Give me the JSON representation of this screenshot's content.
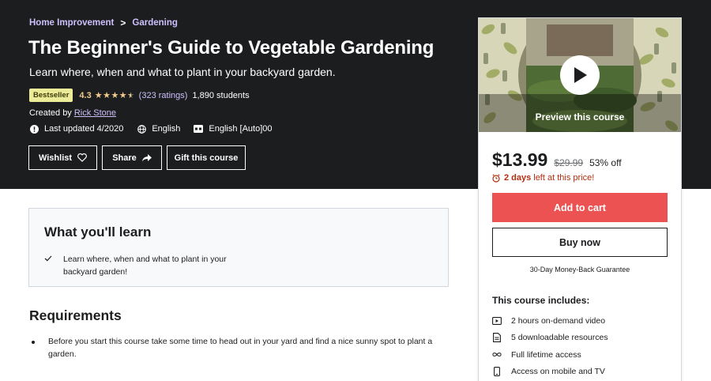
{
  "breadcrumb": {
    "items": [
      "Home Improvement",
      "Gardening"
    ],
    "separator": ">"
  },
  "course": {
    "title": "The Beginner's Guide to Vegetable Gardening",
    "subtitle": "Learn where, when and what to plant in your backyard garden.",
    "badge": "Bestseller",
    "rating": "4.3",
    "rating_value": 4.3,
    "rating_max": 5,
    "ratings_count": "(323 ratings)",
    "students": "1,890 students",
    "created_by_label": "Created by",
    "instructor": "Rick Stone",
    "last_updated": "Last updated 4/2020",
    "language": "English",
    "captions": "English [Auto]00"
  },
  "actions": {
    "wishlist": "Wishlist",
    "share": "Share",
    "gift": "Gift this course"
  },
  "sidebar": {
    "preview_label": "Preview this course",
    "price": "$13.99",
    "original_price": "$29.99",
    "discount": "53% off",
    "timer_count": "2 days",
    "timer_text": "left at this price!",
    "add_to_cart": "Add to cart",
    "buy_now": "Buy now",
    "guarantee": "30-Day Money-Back Guarantee",
    "includes_title": "This course includes:",
    "includes": [
      {
        "icon": "video-icon",
        "text": "2 hours on-demand video"
      },
      {
        "icon": "file-icon",
        "text": "5 downloadable resources"
      },
      {
        "icon": "infinity-icon",
        "text": "Full lifetime access"
      },
      {
        "icon": "mobile-icon",
        "text": "Access on mobile and TV"
      }
    ]
  },
  "learn": {
    "title": "What you'll learn",
    "items": [
      "Learn where, when and what to plant in your backyard garden!"
    ]
  },
  "requirements": {
    "title": "Requirements",
    "items": [
      "Before you start this course take some time to head out in your yard and find a nice sunny spot to plant a garden."
    ]
  },
  "colors": {
    "hero_bg": "#1c1d1f",
    "link_purple": "#cec0fc",
    "star_gold": "#f3ca8c",
    "badge_bg": "#eceb98",
    "cart_red": "#ec5252",
    "timer_red": "#b32d0f"
  }
}
